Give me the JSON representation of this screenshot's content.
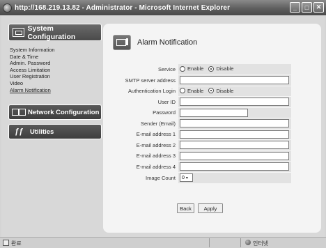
{
  "window": {
    "title": "http://168.219.13.82 - Administrator - Microsoft Internet Explorer",
    "min_glyph": "_",
    "max_glyph": "□",
    "close_glyph": "✕"
  },
  "sidebar": {
    "system_header": "System Configuration",
    "items": [
      {
        "label": "System Information"
      },
      {
        "label": "Date & Time"
      },
      {
        "label": "Admin. Password"
      },
      {
        "label": "Access Limitation"
      },
      {
        "label": "User Registration"
      },
      {
        "label": "Video"
      },
      {
        "label": "Alarm Notification"
      }
    ],
    "network_header": "Network Configuration",
    "utilities_header": "Utilities"
  },
  "panel": {
    "title": "Alarm Notification"
  },
  "form": {
    "service": {
      "label": "Service",
      "options": [
        "Enable",
        "Disable"
      ],
      "selected": "Disable"
    },
    "smtp_label": "SMTP server address",
    "smtp_value": "",
    "auth_login": {
      "label": "Authentication Login",
      "options": [
        "Enable",
        "Disable"
      ],
      "selected": "Disable"
    },
    "user_id_label": "User ID",
    "user_id_value": "",
    "password_label": "Password",
    "password_value": "",
    "sender_label": "Sender (Email)",
    "sender_value": "",
    "email1_label": "E-mail address 1",
    "email1_value": "",
    "email2_label": "E-mail address 2",
    "email2_value": "",
    "email3_label": "E-mail address 3",
    "email3_value": "",
    "email4_label": "E-mail address 4",
    "email4_value": "",
    "image_count_label": "Image Count",
    "image_count_value": "0"
  },
  "buttons": {
    "back": "Back",
    "apply": "Apply"
  },
  "statusbar": {
    "left_text": "완료",
    "right_text": "인터넷"
  },
  "icons": {
    "titlebar": "ie-globe-icon",
    "system": "system-config-icon",
    "network": "network-config-icon",
    "utilities": "utilities-icon",
    "header": "alarm-notification-icon"
  }
}
